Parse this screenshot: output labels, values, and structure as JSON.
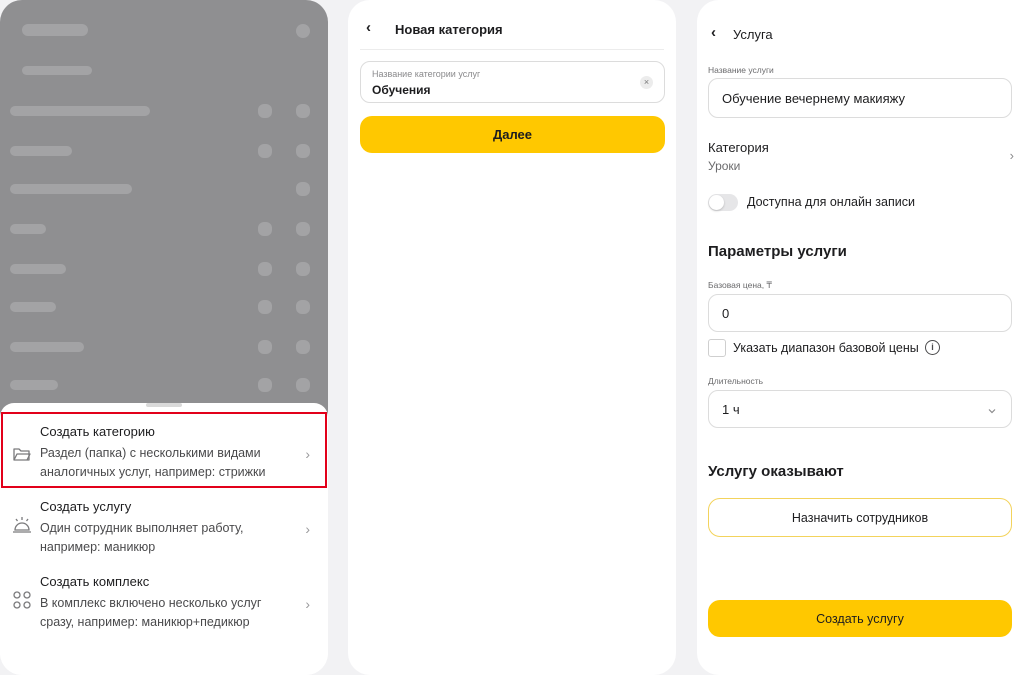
{
  "panel1": {
    "sheet_items": [
      {
        "title": "Создать категорию",
        "description": "Раздел (папка) с несколькими видами аналогичных услуг, например: стрижки",
        "icon": "folder-icon"
      },
      {
        "title": "Создать услугу",
        "description": "Один сотрудник выполняет работу, например: маникюр",
        "icon": "service-bell-icon"
      },
      {
        "title": "Создать комплекс",
        "description": "В комплекс включено несколько услуг сразу, например: маникюр+педикюр",
        "icon": "complex-icon"
      }
    ]
  },
  "panel2": {
    "title": "Новая категория",
    "field_label": "Название категории услуг",
    "field_value": "Обучения",
    "next_label": "Далее"
  },
  "panel3": {
    "title": "Услуга",
    "name_label": "Название услуги",
    "name_value": "Обучение вечернему макияжу",
    "category_label": "Категория",
    "category_value": "Уроки",
    "online_toggle_label": "Доступна для онлайн записи",
    "params_heading": "Параметры услуги",
    "price_label": "Базовая цена, ₸",
    "price_value": "0",
    "range_checkbox_label": "Указать диапазон базовой цены",
    "duration_label": "Длительность",
    "duration_value": "1 ч",
    "providers_heading": "Услугу оказывают",
    "assign_label": "Назначить сотрудников",
    "create_label": "Создать услугу"
  },
  "colors": {
    "accent": "#ffc800",
    "highlight_border": "#e2001a",
    "assign_border": "#f3d35c"
  }
}
